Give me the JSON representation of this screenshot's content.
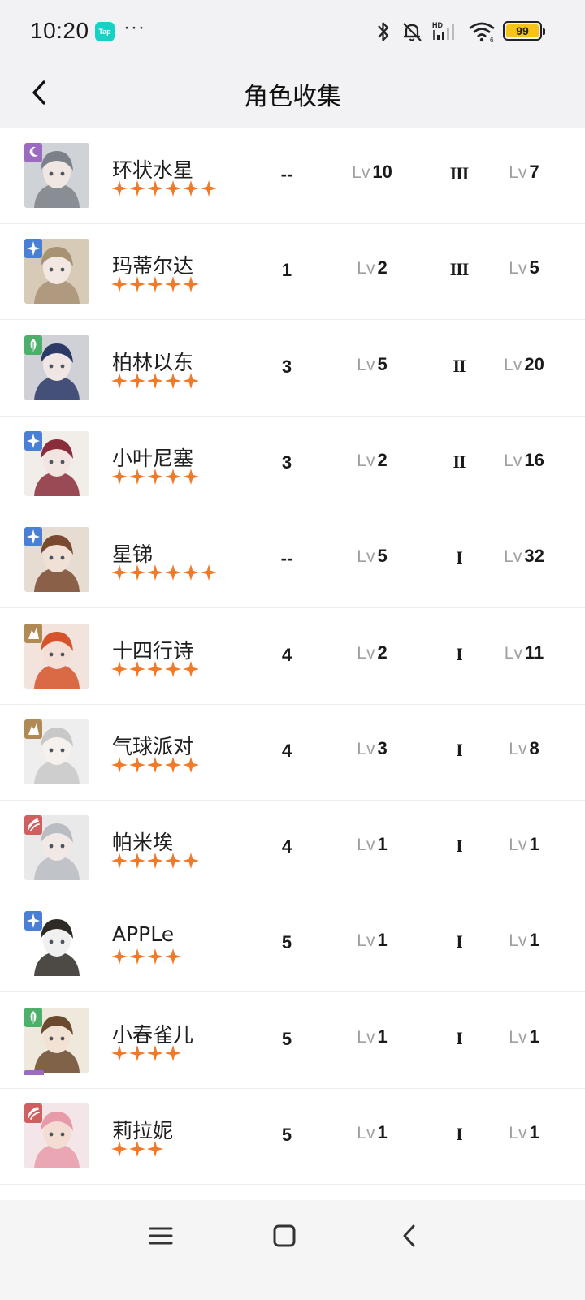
{
  "status_bar": {
    "time": "10:20",
    "app_badge": "Tap",
    "more": "···",
    "battery_level": "99",
    "network_label": "HD",
    "accent": "#f5c319"
  },
  "header": {
    "title": "角色收集"
  },
  "colors": {
    "star": "#f07a2a",
    "badge_purple": "#9b6bc2",
    "badge_blue": "#4a7fd6",
    "badge_green": "#4caf6a",
    "badge_tan": "#b08a55",
    "badge_red": "#d06060"
  },
  "characters": [
    {
      "name": "环状水星",
      "stars": 6,
      "badge": "moon-badge-icon",
      "stage": "--",
      "lv_prefix": "Lv",
      "level": "10",
      "tier": "III",
      "skill_prefix": "Lv",
      "skill": "7"
    },
    {
      "name": "玛蒂尔达",
      "stars": 5,
      "badge": "star-badge-icon",
      "stage": "1",
      "lv_prefix": "Lv",
      "level": "2",
      "tier": "III",
      "skill_prefix": "Lv",
      "skill": "5"
    },
    {
      "name": "柏林以东",
      "stars": 5,
      "badge": "leaf-badge-icon",
      "stage": "3",
      "lv_prefix": "Lv",
      "level": "5",
      "tier": "II",
      "skill_prefix": "Lv",
      "skill": "20"
    },
    {
      "name": "小叶尼塞",
      "stars": 5,
      "badge": "star-badge-icon",
      "stage": "3",
      "lv_prefix": "Lv",
      "level": "2",
      "tier": "II",
      "skill_prefix": "Lv",
      "skill": "16"
    },
    {
      "name": "星锑",
      "stars": 6,
      "badge": "star-badge-icon",
      "stage": "--",
      "lv_prefix": "Lv",
      "level": "5",
      "tier": "I",
      "skill_prefix": "Lv",
      "skill": "32"
    },
    {
      "name": "十四行诗",
      "stars": 5,
      "badge": "beast-badge-icon",
      "stage": "4",
      "lv_prefix": "Lv",
      "level": "2",
      "tier": "I",
      "skill_prefix": "Lv",
      "skill": "11"
    },
    {
      "name": "气球派对",
      "stars": 5,
      "badge": "beast-badge-icon",
      "stage": "4",
      "lv_prefix": "Lv",
      "level": "3",
      "tier": "I",
      "skill_prefix": "Lv",
      "skill": "8"
    },
    {
      "name": "帕米埃",
      "stars": 5,
      "badge": "flame-badge-icon",
      "stage": "4",
      "lv_prefix": "Lv",
      "level": "1",
      "tier": "I",
      "skill_prefix": "Lv",
      "skill": "1"
    },
    {
      "name": "APPLe",
      "stars": 4,
      "badge": "star-badge-icon",
      "stage": "5",
      "lv_prefix": "Lv",
      "level": "1",
      "tier": "I",
      "skill_prefix": "Lv",
      "skill": "1"
    },
    {
      "name": "小春雀儿",
      "stars": 4,
      "badge": "leaf-badge-icon",
      "stage": "5",
      "lv_prefix": "Lv",
      "level": "1",
      "tier": "I",
      "skill_prefix": "Lv",
      "skill": "1"
    },
    {
      "name": "莉拉妮",
      "stars": 3,
      "badge": "flame-badge-icon",
      "stage": "5",
      "lv_prefix": "Lv",
      "level": "1",
      "tier": "I",
      "skill_prefix": "Lv",
      "skill": "1"
    }
  ],
  "nav": {
    "menu": "menu-icon",
    "home": "home-square-icon",
    "back": "back-chevron-icon"
  }
}
